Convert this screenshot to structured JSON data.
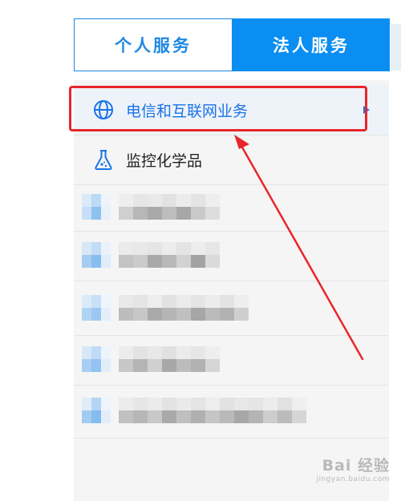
{
  "tabs": {
    "personal_label": "个人服务",
    "legal_label": "法人服务"
  },
  "menu": {
    "items": [
      {
        "label": "电信和互联网业务",
        "icon": "globe-icon",
        "selected": true,
        "has_submenu": true
      },
      {
        "label": "监控化学品",
        "icon": "flask-icon",
        "selected": false,
        "has_submenu": false
      }
    ]
  },
  "colors": {
    "accent": "#1e88e5",
    "tab_active_bg": "#0b8ef2",
    "highlight": "#e8262a",
    "panel_bg": "#f5f5f5"
  },
  "watermark": {
    "main": "Bai 经验",
    "sub": "jingyan.baidu.com"
  }
}
